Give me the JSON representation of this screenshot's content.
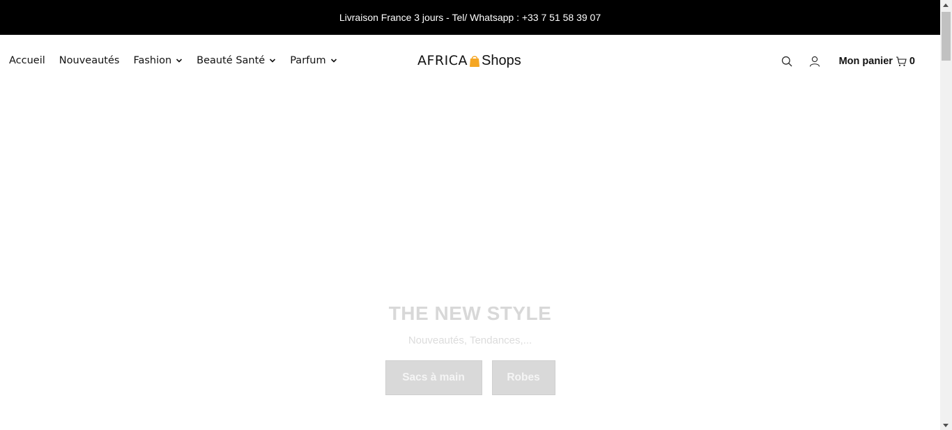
{
  "announcement": {
    "text": "Livraison France 3 jours - Tel/ Whatsapp : +33 7 51 58 39 07"
  },
  "nav": {
    "items": [
      {
        "label": "Accueil",
        "dropdown": false
      },
      {
        "label": "Nouveautés",
        "dropdown": false
      },
      {
        "label": "Fashion",
        "dropdown": true
      },
      {
        "label": "Beauté Santé",
        "dropdown": true
      },
      {
        "label": "Parfum",
        "dropdown": true
      }
    ]
  },
  "logo": {
    "part1": "AFRICA",
    "part2": "Shops",
    "accent_color": "#f5a623"
  },
  "header_icons": {
    "search": "search-icon",
    "account": "user-icon",
    "cart": "cart-icon"
  },
  "cart": {
    "label": "Mon panier",
    "count": "0"
  },
  "hero": {
    "title": "THE NEW STYLE",
    "subtitle": "Nouveautés, Tendances,...",
    "buttons": [
      "Sacs à main",
      "Robes"
    ]
  }
}
